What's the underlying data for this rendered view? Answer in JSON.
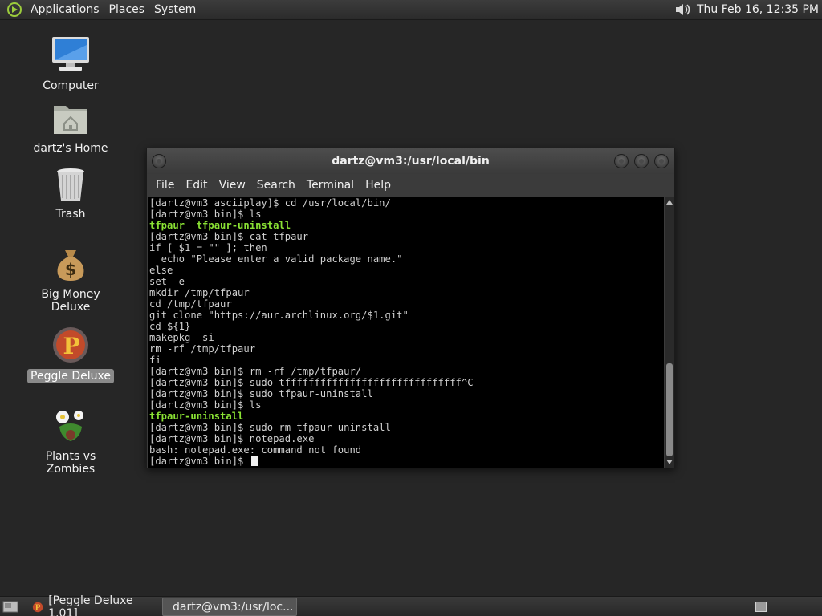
{
  "top_panel": {
    "menus": [
      "Applications",
      "Places",
      "System"
    ],
    "clock": "Thu Feb 16, 12:35 PM",
    "volume_icon": "volume-icon"
  },
  "desktop_icons": [
    {
      "label": "Computer",
      "icon": "computer-icon",
      "selected": false
    },
    {
      "label": "dartz's Home",
      "icon": "home-folder-icon",
      "selected": false
    },
    {
      "label": "Trash",
      "icon": "trash-icon",
      "selected": false
    },
    {
      "label": "Big Money Deluxe",
      "icon": "money-bag-icon",
      "selected": false
    },
    {
      "label": "Peggle Deluxe",
      "icon": "peggle-icon",
      "selected": true
    },
    {
      "label": "Plants vs Zombies",
      "icon": "plants-icon",
      "selected": false
    }
  ],
  "terminal": {
    "title": "dartz@vm3:/usr/local/bin",
    "menus": [
      "File",
      "Edit",
      "View",
      "Search",
      "Terminal",
      "Help"
    ],
    "lines": [
      {
        "text": "[dartz@vm3 asciiplay]$ cd /usr/local/bin/",
        "color": "default"
      },
      {
        "text": "[dartz@vm3 bin]$ ls",
        "color": "default"
      },
      {
        "text": "tfpaur  tfpaur-uninstall",
        "color": "green"
      },
      {
        "text": "[dartz@vm3 bin]$ cat tfpaur",
        "color": "default"
      },
      {
        "text": "if [ $1 = \"\" ]; then",
        "color": "default"
      },
      {
        "text": "  echo \"Please enter a valid package name.\"",
        "color": "default"
      },
      {
        "text": "else",
        "color": "default"
      },
      {
        "text": "set -e",
        "color": "default"
      },
      {
        "text": "mkdir /tmp/tfpaur",
        "color": "default"
      },
      {
        "text": "cd /tmp/tfpaur",
        "color": "default"
      },
      {
        "text": "git clone \"https://aur.archlinux.org/$1.git\"",
        "color": "default"
      },
      {
        "text": "cd ${1}",
        "color": "default"
      },
      {
        "text": "makepkg -si",
        "color": "default"
      },
      {
        "text": "rm -rf /tmp/tfpaur",
        "color": "default"
      },
      {
        "text": "fi",
        "color": "default"
      },
      {
        "text": "[dartz@vm3 bin]$ rm -rf /tmp/tfpaur/",
        "color": "default"
      },
      {
        "text": "[dartz@vm3 bin]$ sudo tffffffffffffffffffffffffffffff^C",
        "color": "default"
      },
      {
        "text": "[dartz@vm3 bin]$ sudo tfpaur-uninstall",
        "color": "default"
      },
      {
        "text": "[dartz@vm3 bin]$ ls",
        "color": "default"
      },
      {
        "text": "tfpaur-uninstall",
        "color": "green"
      },
      {
        "text": "[dartz@vm3 bin]$ sudo rm tfpaur-uninstall",
        "color": "default"
      },
      {
        "text": "[dartz@vm3 bin]$ notepad.exe",
        "color": "default"
      },
      {
        "text": "bash: notepad.exe: command not found",
        "color": "default"
      }
    ],
    "prompt": "[dartz@vm3 bin]$ ",
    "colors": {
      "output_green": "#8ae234",
      "text": "#d0d0d0",
      "background": "#000000"
    }
  },
  "taskbar": {
    "tasks": [
      {
        "label": "[Peggle Deluxe 1.01]",
        "icon": "peggle-icon",
        "active": false
      },
      {
        "label": "dartz@vm3:/usr/loc...",
        "icon": "terminal-icon",
        "active": true
      }
    ],
    "show_desktop_icon": "show-desktop-icon",
    "workspace_icon": "workspace-switcher-icon"
  }
}
